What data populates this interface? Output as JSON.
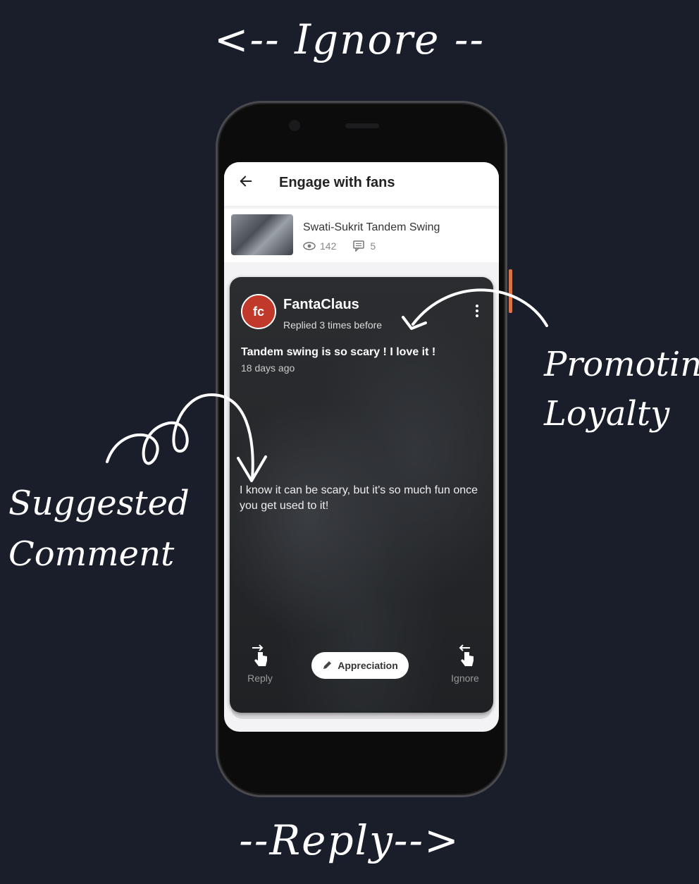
{
  "annotations": {
    "top": "<-- Ignore --",
    "bottom": "--Reply-->",
    "right": [
      "Promoting",
      "Loyalty"
    ],
    "left": [
      "Suggested",
      "Comment"
    ]
  },
  "app": {
    "title": "Engage with fans",
    "video": {
      "title": "Swati-Sukrit Tandem Swing",
      "views": "142",
      "comments": "5"
    },
    "card": {
      "avatar_text": "fc",
      "username": "FantaClaus",
      "replied_info": "Replied 3 times before",
      "comment": "Tandem swing is so scary ! I love it !",
      "time_ago": "18 days ago",
      "suggested_reply": "I know it can be scary, but it's so much fun once you get used to it!",
      "reply_label": "Reply",
      "ignore_label": "Ignore",
      "chip_label": "Appreciation"
    }
  },
  "colors": {
    "background": "#1a1e2b",
    "avatar": "#c0392b",
    "side_button": "#d9744a"
  },
  "icons": [
    "back-arrow-icon",
    "eye-icon",
    "comment-icon",
    "kebab-menu-icon",
    "swipe-right-icon",
    "swipe-left-icon",
    "pencil-icon"
  ]
}
